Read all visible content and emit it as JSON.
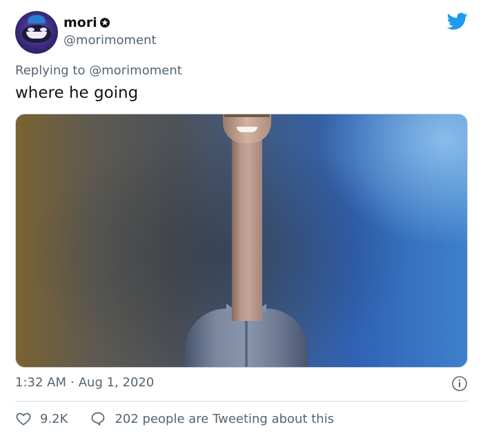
{
  "user": {
    "display_name": "mori",
    "handle": "@morimoment"
  },
  "reply": {
    "prefix": "Replying to",
    "mention": "@morimoment"
  },
  "tweet": {
    "text": "where he going"
  },
  "meta": {
    "time": "1:32 AM",
    "separator": "·",
    "date": "Aug 1, 2020"
  },
  "engagement": {
    "likes": "9.2K",
    "replies_text": "202 people are Tweeting about this"
  },
  "colors": {
    "twitter_blue": "#1d9bf0",
    "muted_text": "#536471"
  },
  "icons": {
    "badge": "badge-icon",
    "brand": "twitter-bird-icon",
    "info": "info-icon",
    "like": "heart-icon",
    "reply": "speech-bubble-icon"
  }
}
